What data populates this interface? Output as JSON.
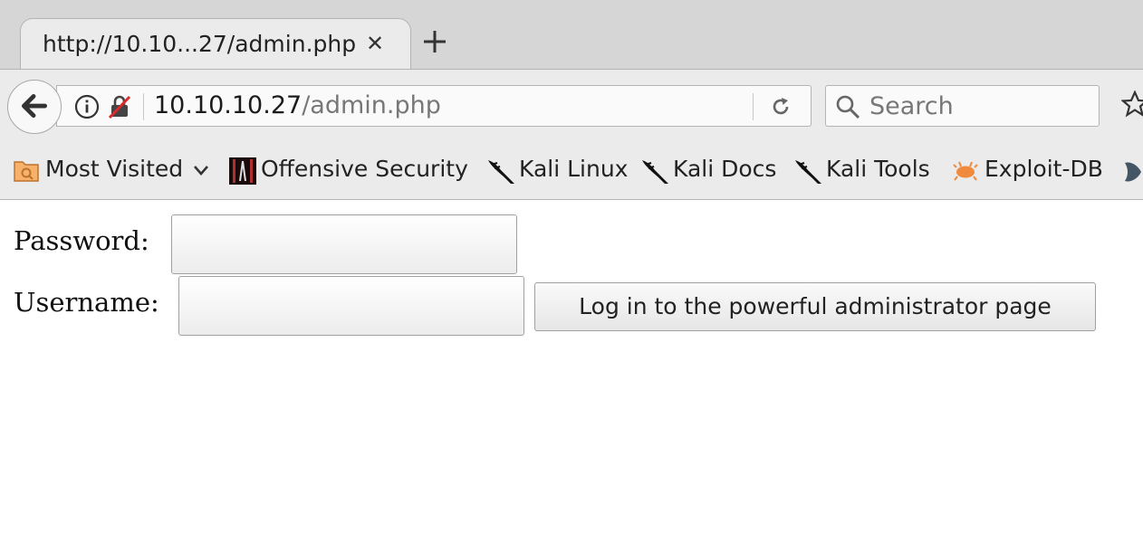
{
  "tab": {
    "title": "http://10.10...27/admin.php",
    "close_glyph": "✕"
  },
  "navbar": {
    "url_host": "10.10.10.27",
    "url_path": "/admin.php",
    "search_placeholder": "Search"
  },
  "bookmarks": [
    {
      "label": "Most Visited",
      "icon": "folder-icon"
    },
    {
      "label": "Offensive Security",
      "icon": "offensive-security-icon"
    },
    {
      "label": "Kali Linux",
      "icon": "kali-dragon-icon"
    },
    {
      "label": "Kali Docs",
      "icon": "kali-dragon-icon"
    },
    {
      "label": "Kali Tools",
      "icon": "kali-dragon-icon"
    },
    {
      "label": "Exploit-DB",
      "icon": "exploit-db-bug-icon"
    }
  ],
  "form": {
    "password_label": "Password:",
    "password_value": "",
    "username_label": "Username:",
    "username_value": "",
    "submit_label": "Log in to the powerful administrator page"
  }
}
